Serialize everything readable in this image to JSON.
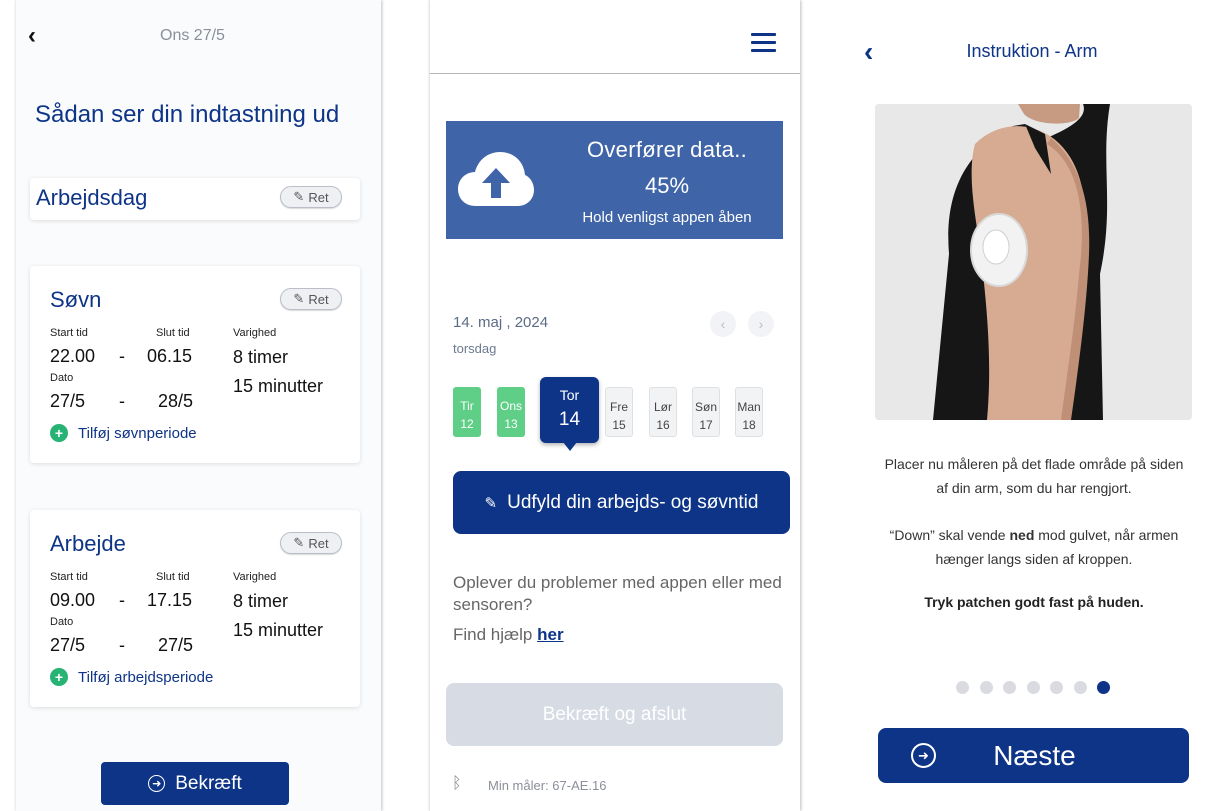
{
  "screen1": {
    "date_header": "Ons 27/5",
    "heading": "Sådan ser din indtastning ud",
    "day_type_card": {
      "title": "Arbejdsdag",
      "edit_label": "Ret"
    },
    "sleep_card": {
      "title": "Søvn",
      "edit_label": "Ret",
      "start_label": "Start tid",
      "end_label": "Slut tid",
      "duration_label": "Varighed",
      "start_time": "22.00",
      "end_time": "06.15",
      "dash": "-",
      "duration_hours": "8 timer",
      "duration_minutes": "15 minutter",
      "date_label": "Dato",
      "start_date": "27/5",
      "end_date": "28/5",
      "add_label": "Tilføj søvnperiode"
    },
    "work_card": {
      "title": "Arbejde",
      "edit_label": "Ret",
      "start_label": "Start tid",
      "end_label": "Slut tid",
      "duration_label": "Varighed",
      "start_time": "09.00",
      "end_time": "17.15",
      "dash": "-",
      "duration_hours": "8 timer",
      "duration_minutes": "15 minutter",
      "date_label": "Dato",
      "start_date": "27/5",
      "end_date": "27/5",
      "add_label": "Tilføj arbejdsperiode"
    },
    "confirm_label": "Bekræft"
  },
  "screen2": {
    "transfer": {
      "title": "Overfører data..",
      "progress": "45%",
      "progress_value": 0.45,
      "subtitle": "Hold venligst appen åben"
    },
    "date_title": "14. maj , 2024",
    "weekday": "torsdag",
    "days": [
      {
        "name": "Tir",
        "num": "12",
        "state": "done"
      },
      {
        "name": "Ons",
        "num": "13",
        "state": "done"
      },
      {
        "name": "Tor",
        "num": "14",
        "state": "selected"
      },
      {
        "name": "Fre",
        "num": "15",
        "state": "future"
      },
      {
        "name": "Lør",
        "num": "16",
        "state": "future"
      },
      {
        "name": "Søn",
        "num": "17",
        "state": "future"
      },
      {
        "name": "Man",
        "num": "18",
        "state": "future"
      }
    ],
    "fill_button_label": "Udfyld din arbejds- og søvntid",
    "help_text": "Oplever du problemer med appen eller med sensoren?",
    "help_prefix": "Find hjælp",
    "help_link": "her",
    "confirm_disabled_label": "Bekræft og afslut",
    "meter_label": "Min måler: 67-AE.16"
  },
  "screen3": {
    "title": "Instruktion - Arm",
    "para1": "Placer nu måleren på det flade område på siden af din arm, som du har rengjort.",
    "para2_pre": "“Down” skal vende ",
    "para2_bold": "ned",
    "para2_post": " mod gulvet, når armen hænger langs siden af kroppen.",
    "para3": "Tryk patchen godt fast på huden.",
    "page_count": 7,
    "active_page": 7,
    "next_label": "Næste"
  },
  "colors": {
    "navy": "#0d3487",
    "transfer_bg": "#3f64a8",
    "green": "#5fcf88",
    "disabled": "#d6dbe4"
  }
}
